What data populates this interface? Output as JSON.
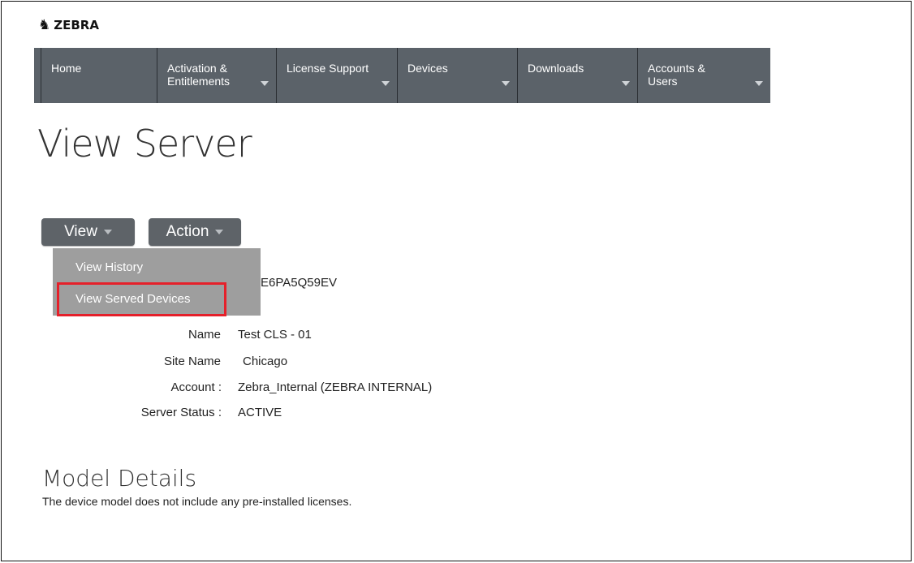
{
  "brand": {
    "logo_text": "ZEBRA"
  },
  "nav": {
    "items": [
      {
        "label": "Home"
      },
      {
        "label": "Activation & Entitlements"
      },
      {
        "label": "License Support"
      },
      {
        "label": "Devices"
      },
      {
        "label": "Downloads"
      },
      {
        "label": "Accounts & Users"
      }
    ]
  },
  "page": {
    "title": "View Server"
  },
  "toolbar": {
    "view_label": "View",
    "action_label": "Action"
  },
  "view_menu": {
    "items": [
      "View History",
      "View Served Devices"
    ],
    "highlighted": "View Served Devices"
  },
  "server": {
    "serial_fragment": "E6PA5Q59EV",
    "fields": [
      {
        "label": "Name",
        "value": "Test CLS - 01"
      },
      {
        "label": "Site Name",
        "value": "Chicago"
      },
      {
        "label": "Account :",
        "value": "Zebra_Internal (ZEBRA INTERNAL)"
      },
      {
        "label": "Server Status :",
        "value": "ACTIVE"
      }
    ]
  },
  "model_details": {
    "title": "Model Details",
    "note": "The device model does not include any pre-installed licenses."
  },
  "colors": {
    "nav_bg": "#5b6269",
    "highlight": "#e5202a",
    "menu_bg": "#9e9e9e"
  }
}
